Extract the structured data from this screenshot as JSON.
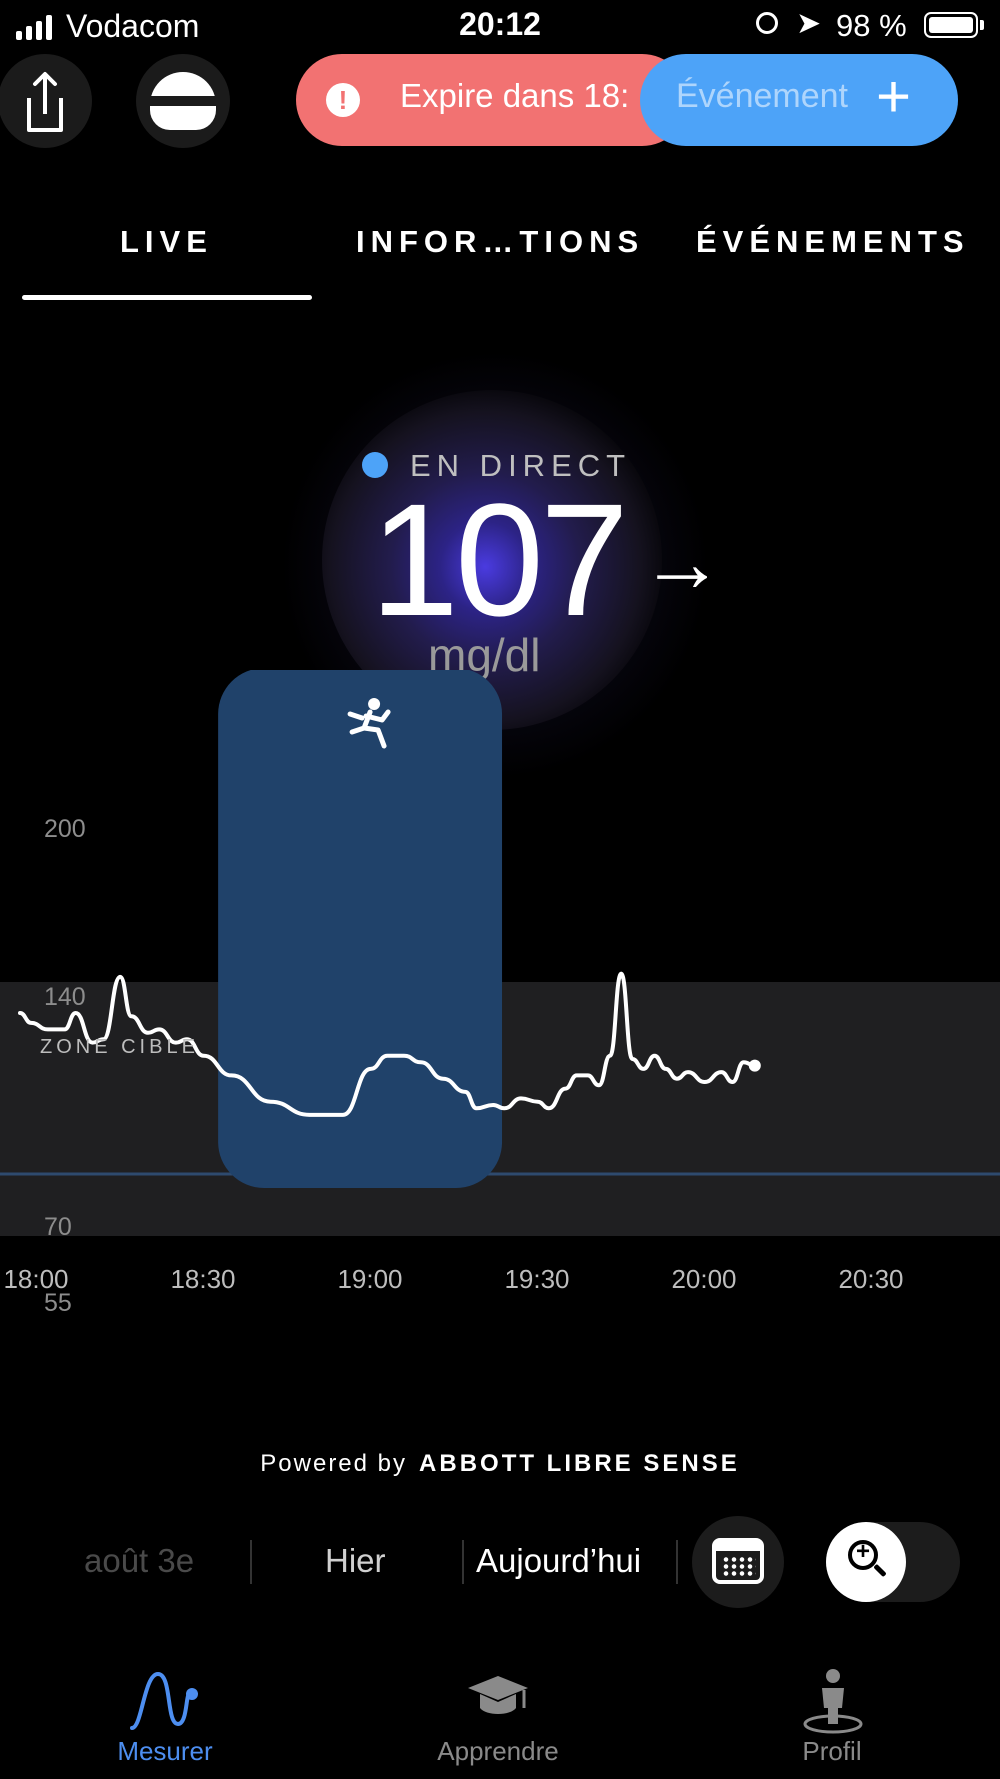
{
  "status_bar": {
    "carrier": "Vodacom",
    "time": "20:12",
    "battery": "98 %"
  },
  "header": {
    "expire_text": "Expire dans 18:",
    "event_label": "Événement",
    "event_plus": "+"
  },
  "tabs": [
    {
      "label": "LIVE",
      "active": true
    },
    {
      "label": "INFOR…TIONS",
      "active": false
    },
    {
      "label": "ÉVÉNEMENTS",
      "active": false
    }
  ],
  "live": {
    "status_label": "EN DIRECT",
    "value": "107",
    "trend_arrow": "→",
    "unit": "mg/dl"
  },
  "chart_data": {
    "type": "line",
    "y_ticks": [
      "200",
      "140",
      "70",
      "55"
    ],
    "x_ticks": [
      "18:00",
      "18:30",
      "19:00",
      "19:30",
      "20:00",
      "20:30"
    ],
    "target_zone_label": "ZONE CIBLE",
    "target_zone": [
      70,
      140
    ],
    "activity_event": {
      "icon": "running-icon",
      "start": "18:32",
      "end": "19:23"
    },
    "series": [
      {
        "x": [
          "18:00",
          "18:02",
          "18:05",
          "18:08",
          "18:10",
          "18:13",
          "18:15",
          "18:18",
          "18:20",
          "18:23",
          "18:25",
          "18:28",
          "18:30",
          "18:33",
          "18:38",
          "18:45",
          "18:52",
          "18:58",
          "19:03",
          "19:06",
          "19:09",
          "19:12",
          "19:16",
          "19:20",
          "19:22",
          "19:25",
          "19:27",
          "19:30",
          "19:33",
          "19:35",
          "19:38",
          "19:40",
          "19:42",
          "19:44",
          "19:46",
          "19:48",
          "19:50",
          "19:52",
          "19:54",
          "19:56",
          "19:58",
          "20:00",
          "20:03",
          "20:06",
          "20:08",
          "20:10",
          "20:12"
        ],
        "values": [
          119,
          116,
          114,
          114,
          119,
          110,
          111,
          130,
          118,
          113,
          114,
          110,
          111,
          106,
          100,
          92,
          88,
          88,
          102,
          106,
          106,
          104,
          99,
          95,
          90,
          91,
          90,
          93,
          92,
          90,
          96,
          100,
          100,
          97,
          106,
          131,
          105,
          102,
          106,
          102,
          99,
          101,
          98,
          101,
          98,
          104,
          103
        ]
      }
    ]
  },
  "powered_by": {
    "prefix": "Powered by",
    "brand": "ABBOTT LIBRE SENSE"
  },
  "date_nav": {
    "prev": "août 3e",
    "yesterday": "Hier",
    "today": "Aujourd’hui"
  },
  "bottom_nav": [
    {
      "label": "Mesurer",
      "icon": "wave-icon",
      "active": true
    },
    {
      "label": "Apprendre",
      "icon": "graduation-cap-icon",
      "active": false
    },
    {
      "label": "Profil",
      "icon": "person-icon",
      "active": false
    }
  ],
  "colors": {
    "accent_blue": "#4da3f8",
    "expire_red": "#f27272",
    "event_bar": "#20426a",
    "nav_active": "#4d8ef0"
  }
}
